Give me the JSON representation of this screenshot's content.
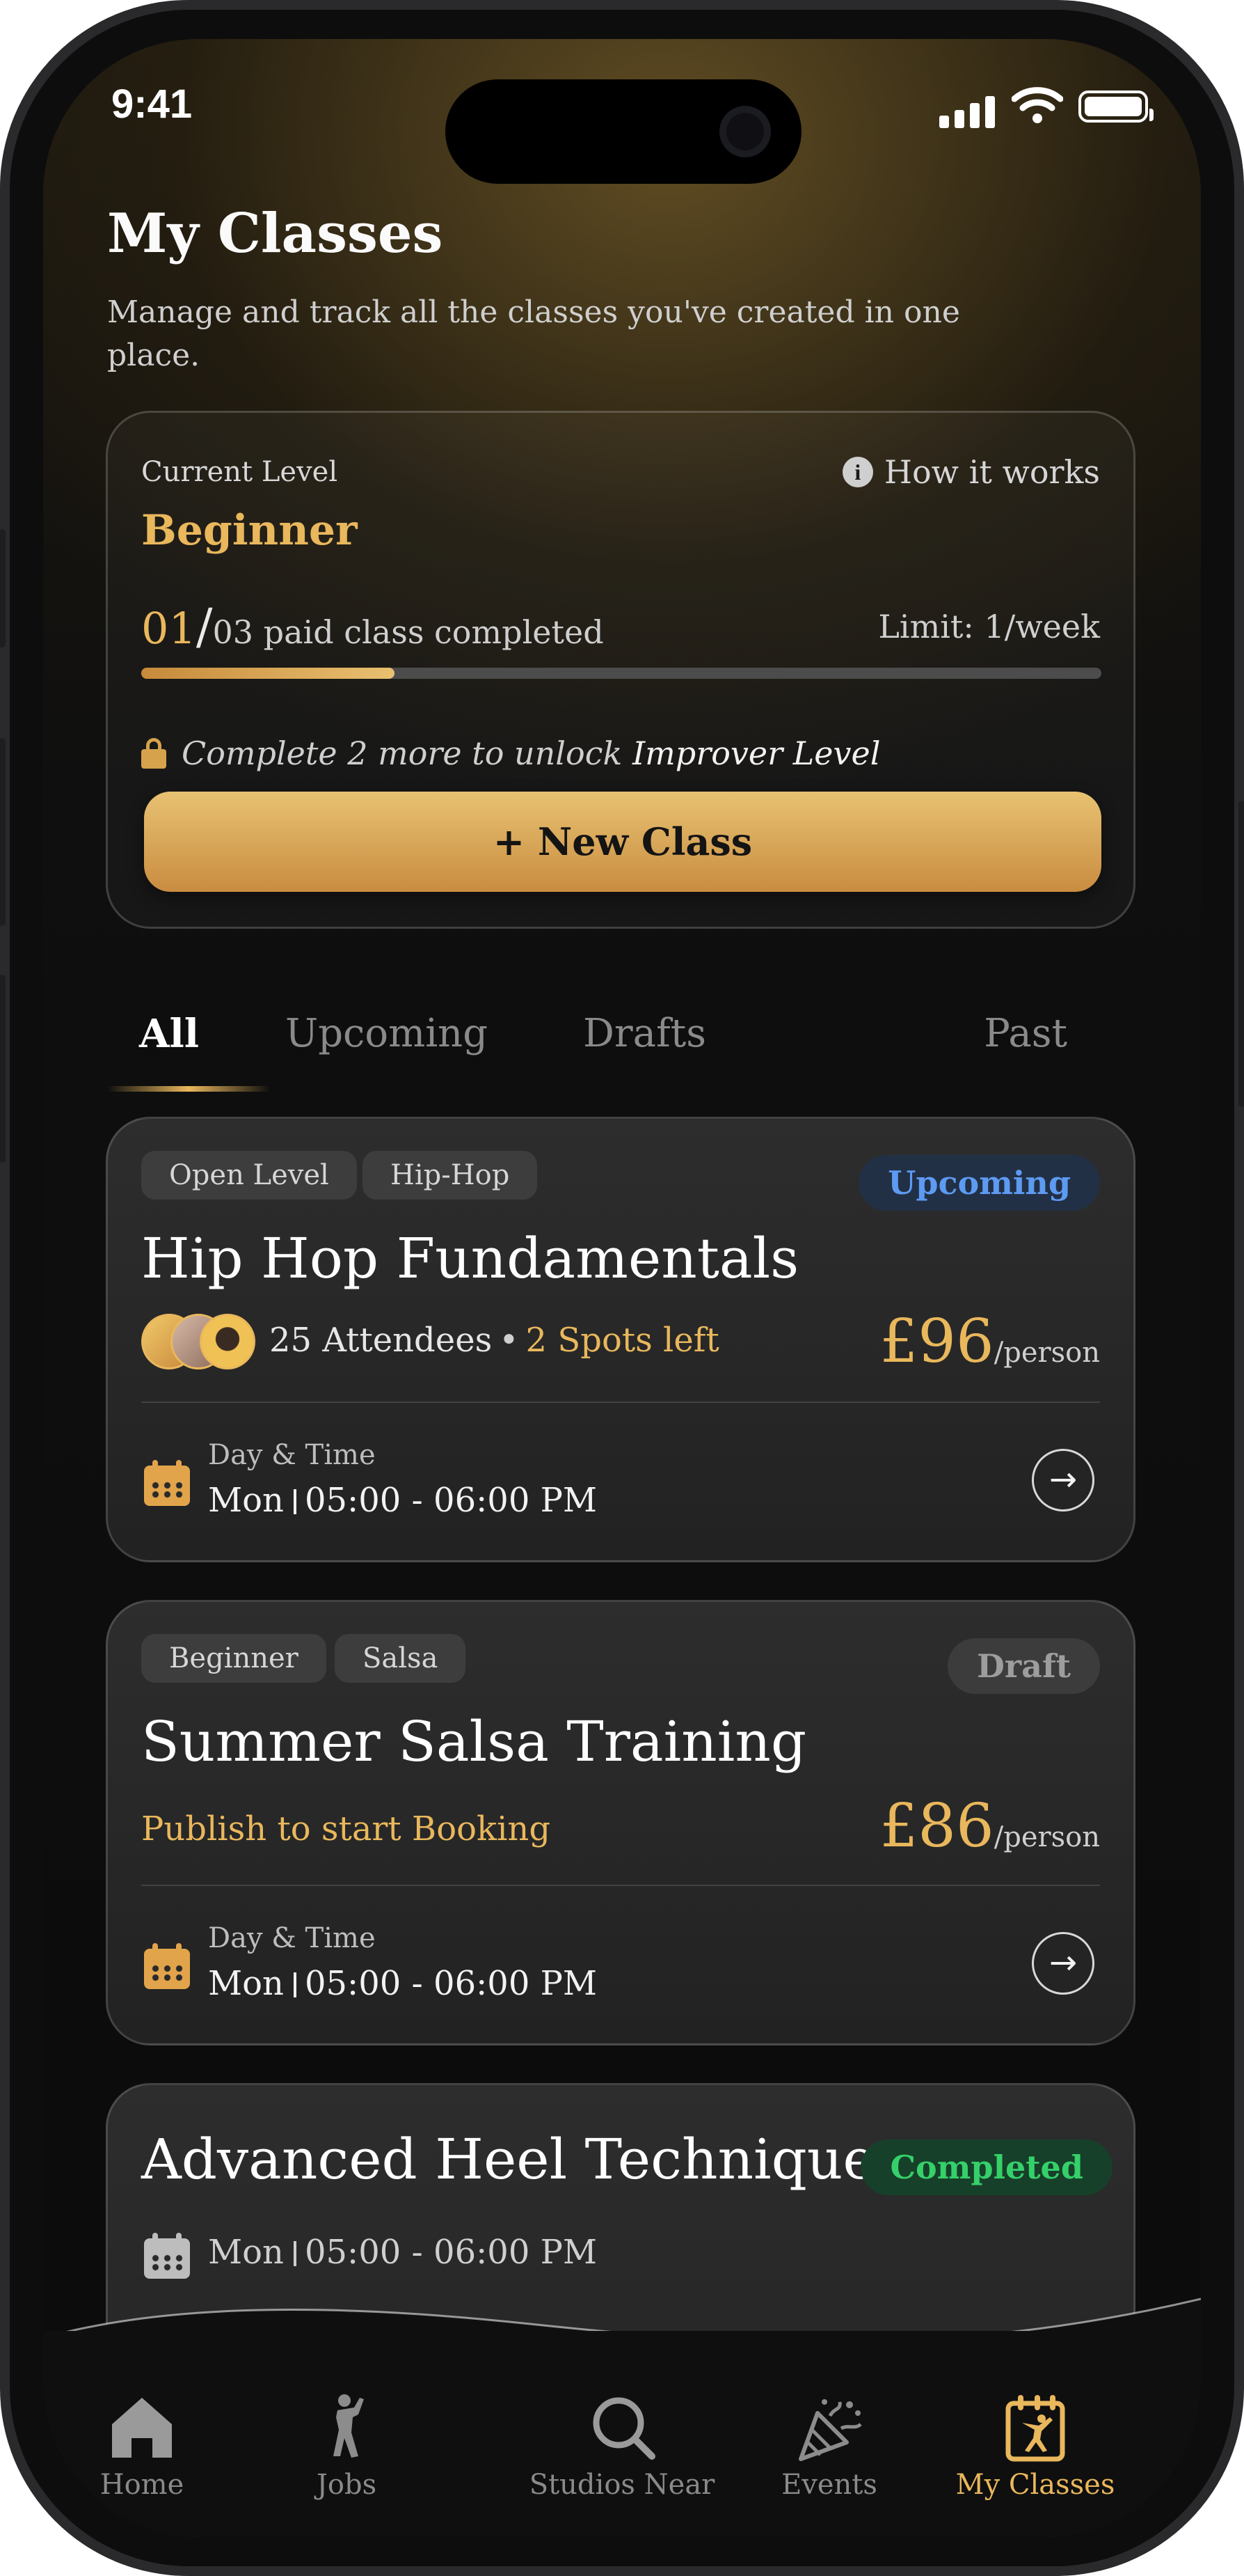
{
  "status_bar": {
    "time": "9:41"
  },
  "header": {
    "title": "My Classes",
    "subtitle": "Manage and track all the classes you've created in one place."
  },
  "level_card": {
    "label": "Current Level",
    "how_it_works": "How it works",
    "level": "Beginner",
    "completed_count": "01",
    "total_text": "03 paid class completed",
    "limit": "Limit: 1/week",
    "progress_fraction": 0.264,
    "unlock_prefix": "Complete 2 more to unlock",
    "unlock_level": "Improver Level",
    "new_class_label": "+ New Class"
  },
  "tabs": [
    {
      "label": "All",
      "active": true
    },
    {
      "label": "Upcoming",
      "active": false
    },
    {
      "label": "Drafts",
      "active": false
    },
    {
      "label": "Past",
      "active": false
    }
  ],
  "classes": [
    {
      "chips": [
        "Open Level",
        "Hip-Hop"
      ],
      "status": "Upcoming",
      "title": "Hip Hop Fundamentals",
      "attendees": "25 Attendees",
      "spots": "2 Spots left",
      "price": "£96",
      "per": "/person",
      "dt_label": "Day & Time",
      "day": "Mon",
      "time": "05:00 - 06:00 PM"
    },
    {
      "chips": [
        "Beginner",
        "Salsa"
      ],
      "status": "Draft",
      "title": "Summer Salsa Training",
      "publish_note": "Publish to start Booking",
      "price": "£86",
      "per": "/person",
      "dt_label": "Day & Time",
      "day": "Mon",
      "time": "05:00 - 06:00 PM"
    },
    {
      "status": "Completed",
      "title": "Advanced Heel Technique",
      "day": "Mon",
      "time": "05:00 - 06:00 PM"
    }
  ],
  "bottom_nav": [
    {
      "label": "Home",
      "icon": "home-icon"
    },
    {
      "label": "Jobs",
      "icon": "dancer-icon"
    },
    {
      "label": "Studios Near",
      "icon": "search-icon"
    },
    {
      "label": "Events",
      "icon": "party-popper-icon"
    },
    {
      "label": "My Classes",
      "icon": "calendar-dancer-icon",
      "active": true
    }
  ],
  "colors": {
    "accent_gold": "#e9b75c",
    "upcoming_blue": "#5d9bf2",
    "completed_green": "#35d06a",
    "card_bg": "#2a2a2a"
  }
}
